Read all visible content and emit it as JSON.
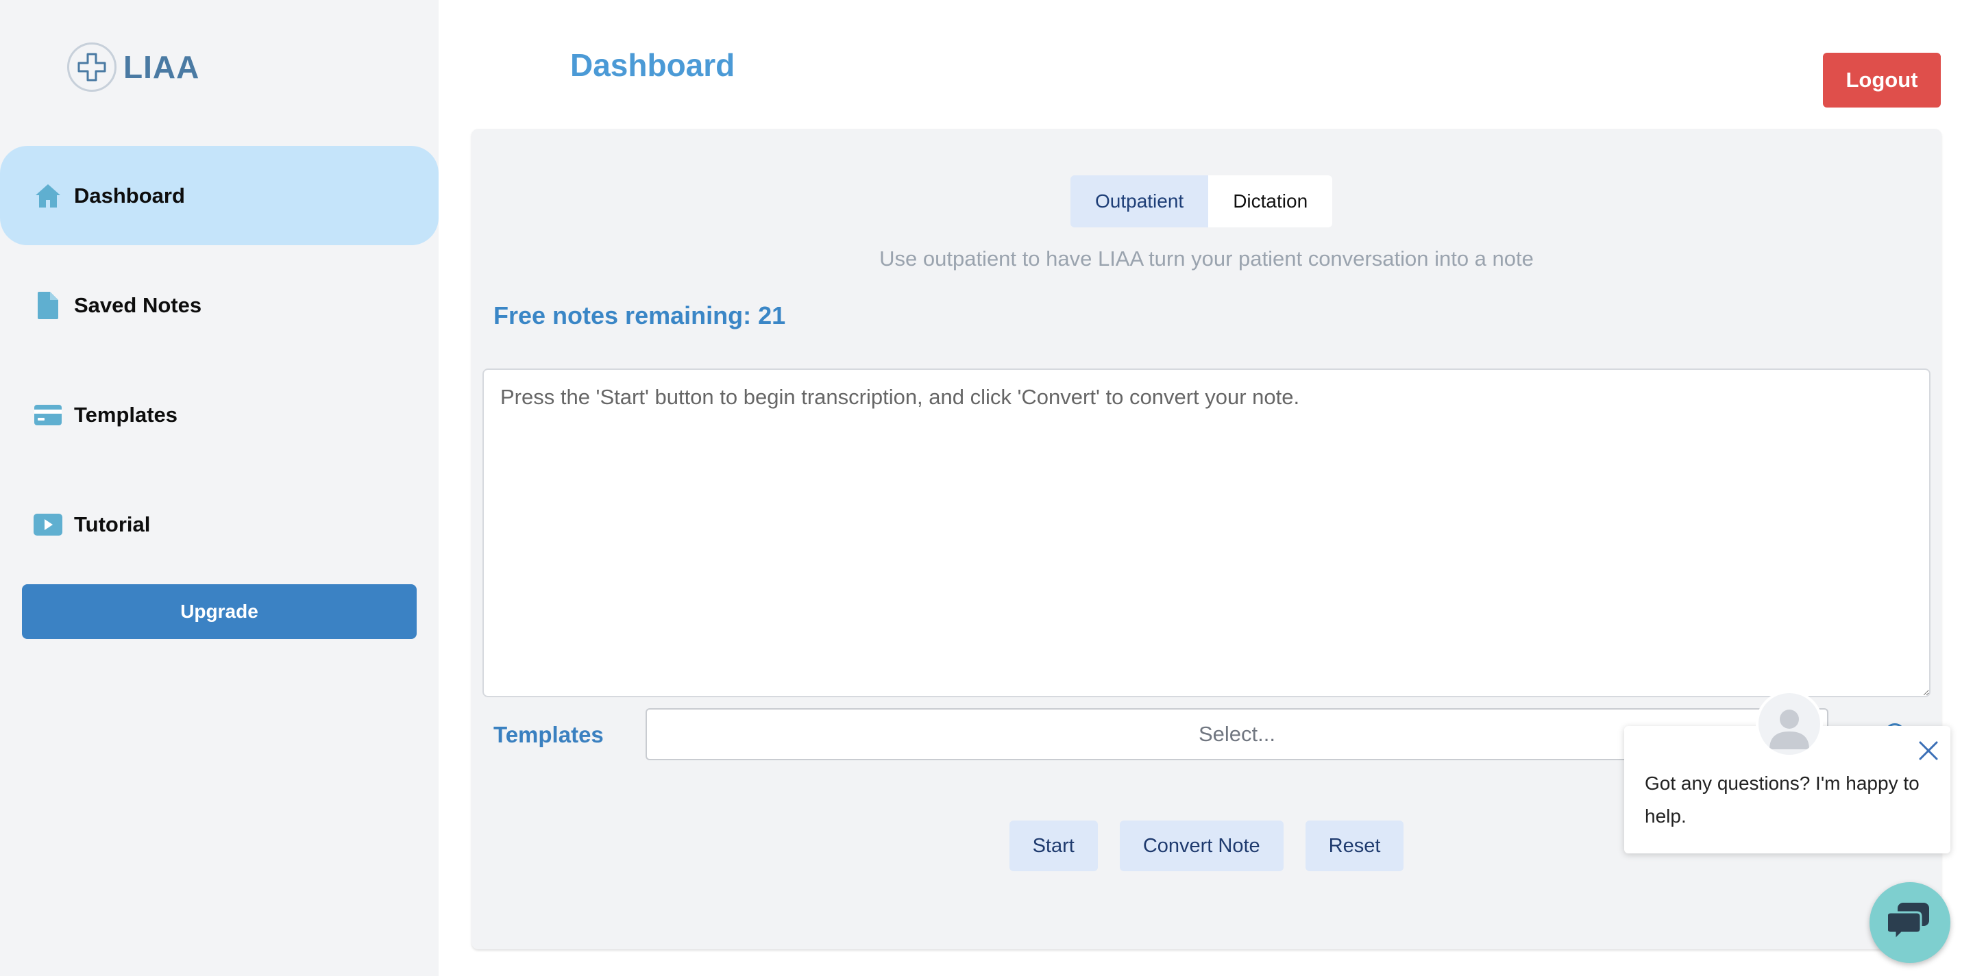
{
  "app": {
    "logo_text": "LIAA"
  },
  "sidebar": {
    "items": [
      {
        "label": "Dashboard",
        "icon": "home-icon",
        "active": true
      },
      {
        "label": "Saved Notes",
        "icon": "document-icon",
        "active": false
      },
      {
        "label": "Templates",
        "icon": "card-icon",
        "active": false
      },
      {
        "label": "Tutorial",
        "icon": "play-icon",
        "active": false
      }
    ],
    "upgrade_label": "Upgrade"
  },
  "header": {
    "title": "Dashboard",
    "logout_label": "Logout"
  },
  "main": {
    "tabs": [
      {
        "label": "Outpatient",
        "active": true
      },
      {
        "label": "Dictation",
        "active": false
      }
    ],
    "mode_hint": "Use outpatient to have LIAA turn your patient conversation into a note",
    "free_notes": "Free notes remaining: 21",
    "note_placeholder": "Press the 'Start' button to begin transcription, and click 'Convert' to convert your note.",
    "templates_label": "Templates",
    "templates_select_placeholder": "Select...",
    "actions": {
      "start": "Start",
      "convert": "Convert Note",
      "reset": "Reset"
    }
  },
  "chat": {
    "message": "Got any questions? I'm happy to help."
  },
  "colors": {
    "accent": "#3b82c4",
    "title_blue": "#4b9ad6",
    "active_nav_bg": "#c5e4fa",
    "logout_red": "#df4f4b",
    "icon_teal": "#5fafd0",
    "chat_launcher": "#7ecfcf"
  }
}
